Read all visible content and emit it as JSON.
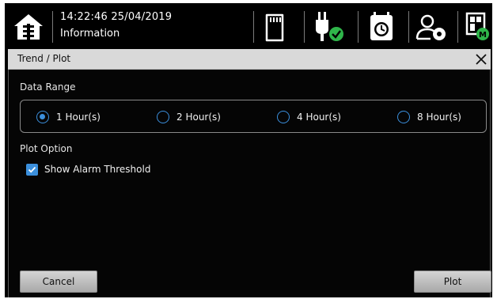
{
  "topbar": {
    "datetime": "14:22:46  25/04/2019",
    "screen_title": "Information",
    "icons": [
      "home-icon",
      "sd-card-icon",
      "power-plug-ok-icon",
      "alarm-clock-icon",
      "user-settings-icon",
      "layout-m-icon"
    ],
    "status_ok_color": "#2fb54a"
  },
  "dialog": {
    "title": "Trend / Plot",
    "data_range_label": "Data Range",
    "range_options": [
      {
        "label": "1 Hour(s)",
        "selected": true
      },
      {
        "label": "2 Hour(s)",
        "selected": false
      },
      {
        "label": "4 Hour(s)",
        "selected": false
      },
      {
        "label": "8 Hour(s)",
        "selected": false
      }
    ],
    "plot_option_label": "Plot Option",
    "show_alarm_threshold_label": "Show Alarm Threshold",
    "show_alarm_threshold_checked": true,
    "cancel_label": "Cancel",
    "plot_label": "Plot",
    "accent_color": "#3b8fdc"
  }
}
